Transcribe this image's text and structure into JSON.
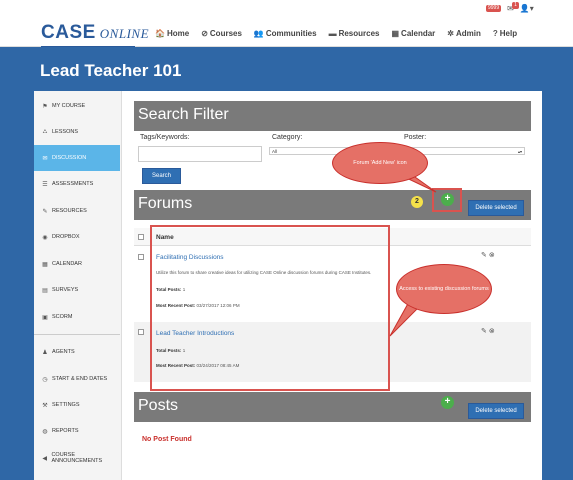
{
  "header": {
    "logo_main": "CASE",
    "logo_sub": "ONLINE",
    "nav": [
      {
        "label": "Home",
        "icon": "home-icon",
        "glyph": "🏠"
      },
      {
        "label": "Courses",
        "icon": "courses-icon",
        "glyph": "⊘"
      },
      {
        "label": "Communities",
        "icon": "communities-icon",
        "glyph": "👥"
      },
      {
        "label": "Resources",
        "icon": "folder-icon",
        "glyph": "▬"
      },
      {
        "label": "Calendar",
        "icon": "calendar-icon",
        "glyph": "▦"
      },
      {
        "label": "Admin",
        "icon": "gear-icon",
        "glyph": "✲"
      },
      {
        "label": "Help",
        "icon": "help-icon",
        "glyph": "?"
      }
    ],
    "notif_count": "9999",
    "mail_count": "1"
  },
  "banner": {
    "title": "Lead Teacher 101"
  },
  "sidebar": {
    "items": [
      {
        "label": "MY COURSE",
        "glyph": "⚑"
      },
      {
        "label": "LESSONS",
        "glyph": "⛼"
      },
      {
        "label": "DISCUSSION",
        "glyph": "✉"
      },
      {
        "label": "ASSESSMENTS",
        "glyph": "☰"
      },
      {
        "label": "RESOURCES",
        "glyph": "✎"
      },
      {
        "label": "DROPBOX",
        "glyph": "◉"
      },
      {
        "label": "CALENDAR",
        "glyph": "▦"
      },
      {
        "label": "SURVEYS",
        "glyph": "▤"
      },
      {
        "label": "SCORM",
        "glyph": "▣"
      },
      {
        "label": "AGENTS",
        "glyph": "♟"
      },
      {
        "label": "START & END DATES",
        "glyph": "◷"
      },
      {
        "label": "SETTINGS",
        "glyph": "⚒"
      },
      {
        "label": "REPORTS",
        "glyph": "◍"
      },
      {
        "label": "COURSE ANNOUNCEMENTS",
        "glyph": "◀"
      }
    ],
    "active_index": 2
  },
  "search": {
    "title": "Search Filter",
    "tags_label": "Tags/Keywords:",
    "category_label": "Category:",
    "poster_label": "Poster:",
    "category_value": "All",
    "search_button": "Search"
  },
  "forums": {
    "title": "Forums",
    "add_icon": "+",
    "delete_button": "Delete selected",
    "column_name": "Name",
    "rows": [
      {
        "name": "Facilitating Discussions",
        "description": "Utilize this forum to share creative ideas for utilizing CASE Online discussion forums during CASE Institutes.",
        "total_posts_label": "Total Posts:",
        "total_posts": "1",
        "recent_label": "Most Recent Post:",
        "recent": "03/27/2017 12:06 PM"
      },
      {
        "name": "Lead Teacher Introductions",
        "description": "",
        "total_posts_label": "Total Posts:",
        "total_posts": "1",
        "recent_label": "Most Recent Post:",
        "recent": "03/24/2017 08:45 AM"
      }
    ]
  },
  "posts": {
    "title": "Posts",
    "add_icon": "+",
    "delete_button": "Delete selected",
    "empty": "No Post Found"
  },
  "annotations": {
    "callout_add": "Forum 'Add New' icon",
    "callout_access": "Access to existing discussion forums",
    "step_number": "2"
  }
}
